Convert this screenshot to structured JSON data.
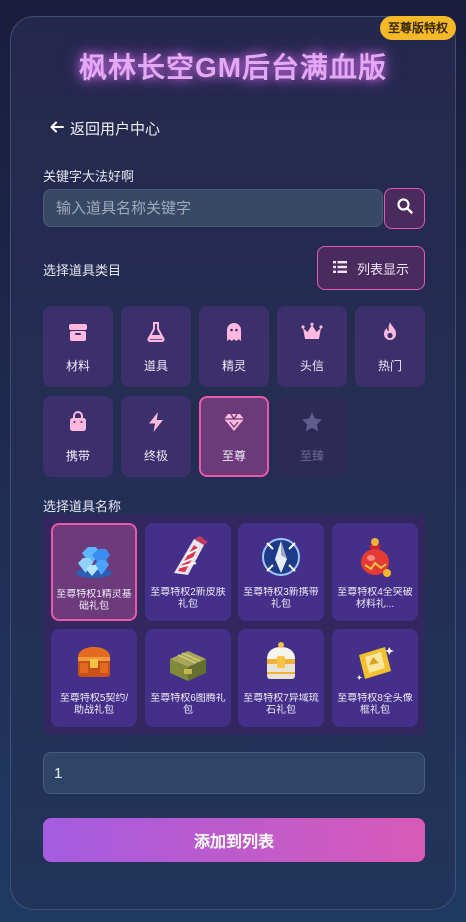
{
  "badge": "至尊版特权",
  "title": "枫林长空GM后台满血版",
  "nav": {
    "back_label": "返回用户中心"
  },
  "search": {
    "label": "关键字大法好啊",
    "placeholder": "输入道具名称关键字"
  },
  "category": {
    "label": "选择道具类目",
    "view_button": "列表显示",
    "items": [
      {
        "label": "材料",
        "icon": "box-icon"
      },
      {
        "label": "道具",
        "icon": "flask-icon"
      },
      {
        "label": "精灵",
        "icon": "ghost-icon"
      },
      {
        "label": "头信",
        "icon": "crown-icon"
      },
      {
        "label": "热门",
        "icon": "fire-icon"
      },
      {
        "label": "携带",
        "icon": "bag-icon"
      },
      {
        "label": "终极",
        "icon": "bolt-icon"
      },
      {
        "label": "至尊",
        "icon": "diamond-icon"
      },
      {
        "label": "至臻",
        "icon": "star-icon"
      }
    ],
    "selected": "至尊"
  },
  "items": {
    "label": "选择道具名称",
    "list": [
      {
        "name": "至尊特权1精灵基础礼包",
        "icon": "gems-icon"
      },
      {
        "name": "至尊特权2新皮肤礼包",
        "icon": "skin-icon"
      },
      {
        "name": "至尊特权3新携带礼包",
        "icon": "carry-icon"
      },
      {
        "name": "至尊特权4全突破材料礼...",
        "icon": "potion-bag-icon"
      },
      {
        "name": "至尊特权5契约/助战礼包",
        "icon": "chest-icon"
      },
      {
        "name": "至尊特权6图腾礼包",
        "icon": "crate-icon"
      },
      {
        "name": "至尊特权7异域琉石礼包",
        "icon": "stone-chest-icon"
      },
      {
        "name": "至尊特权8全头像框礼包",
        "icon": "frame-icon"
      }
    ],
    "selected_index": 0
  },
  "quantity": {
    "value": "1"
  },
  "actions": {
    "add_label": "添加到列表"
  },
  "colors": {
    "accent": "#e05bb2",
    "badge": "#f5b829",
    "card": "#3b2f6c"
  }
}
